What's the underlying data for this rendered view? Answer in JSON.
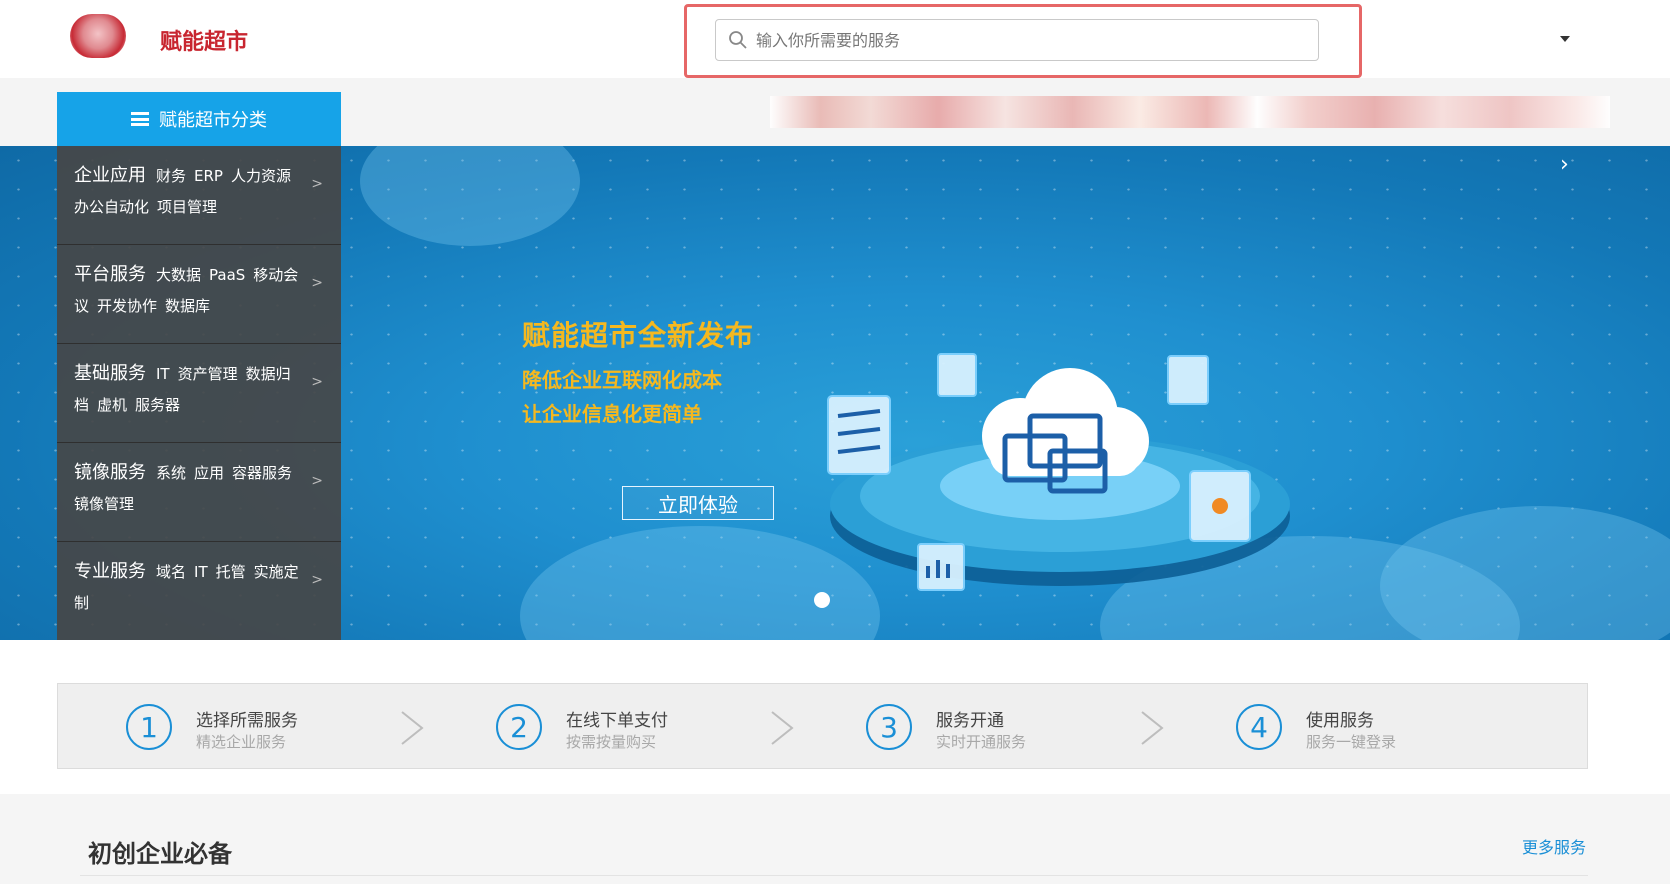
{
  "header": {
    "logo_text": "赋能超市",
    "search": {
      "placeholder": "输入你所需要的服务",
      "value": ""
    }
  },
  "nav": {
    "category_toggle_label": "赋能超市分类"
  },
  "categories": [
    {
      "title": "企业应用",
      "subs": [
        "财务",
        "ERP",
        "人力资源",
        "办公自动化",
        "项目管理"
      ]
    },
    {
      "title": "平台服务",
      "subs": [
        "大数据",
        "PaaS",
        "移动会议",
        "开发协作",
        "数据库"
      ]
    },
    {
      "title": "基础服务",
      "subs": [
        "IT",
        "资产管理",
        "数据归档",
        "虚机",
        "服务器"
      ]
    },
    {
      "title": "镜像服务",
      "subs": [
        "系统",
        "应用",
        "容器服务",
        "镜像管理"
      ]
    },
    {
      "title": "专业服务",
      "subs": [
        "域名",
        "IT",
        "托管",
        "实施定制"
      ]
    }
  ],
  "banner": {
    "title": "赋能超市全新发布",
    "subtitle_1": "降低企业互联网化成本",
    "subtitle_2": "让企业信息化更简单",
    "cta": "立即体验",
    "next": "›"
  },
  "steps": [
    {
      "num": "1",
      "title": "选择所需服务",
      "sub": "精选企业服务"
    },
    {
      "num": "2",
      "title": "在线下单支付",
      "sub": "按需按量购买"
    },
    {
      "num": "3",
      "title": "服务开通",
      "sub": "实时开通服务"
    },
    {
      "num": "4",
      "title": "使用服务",
      "sub": "服务一键登录"
    }
  ],
  "section": {
    "title": "初创企业必备",
    "more": "更多服务"
  },
  "colors": {
    "accent": "#16a3e8",
    "brand_red": "#c8252f",
    "banner_text": "#f5b81f",
    "link": "#1a8fd6"
  }
}
